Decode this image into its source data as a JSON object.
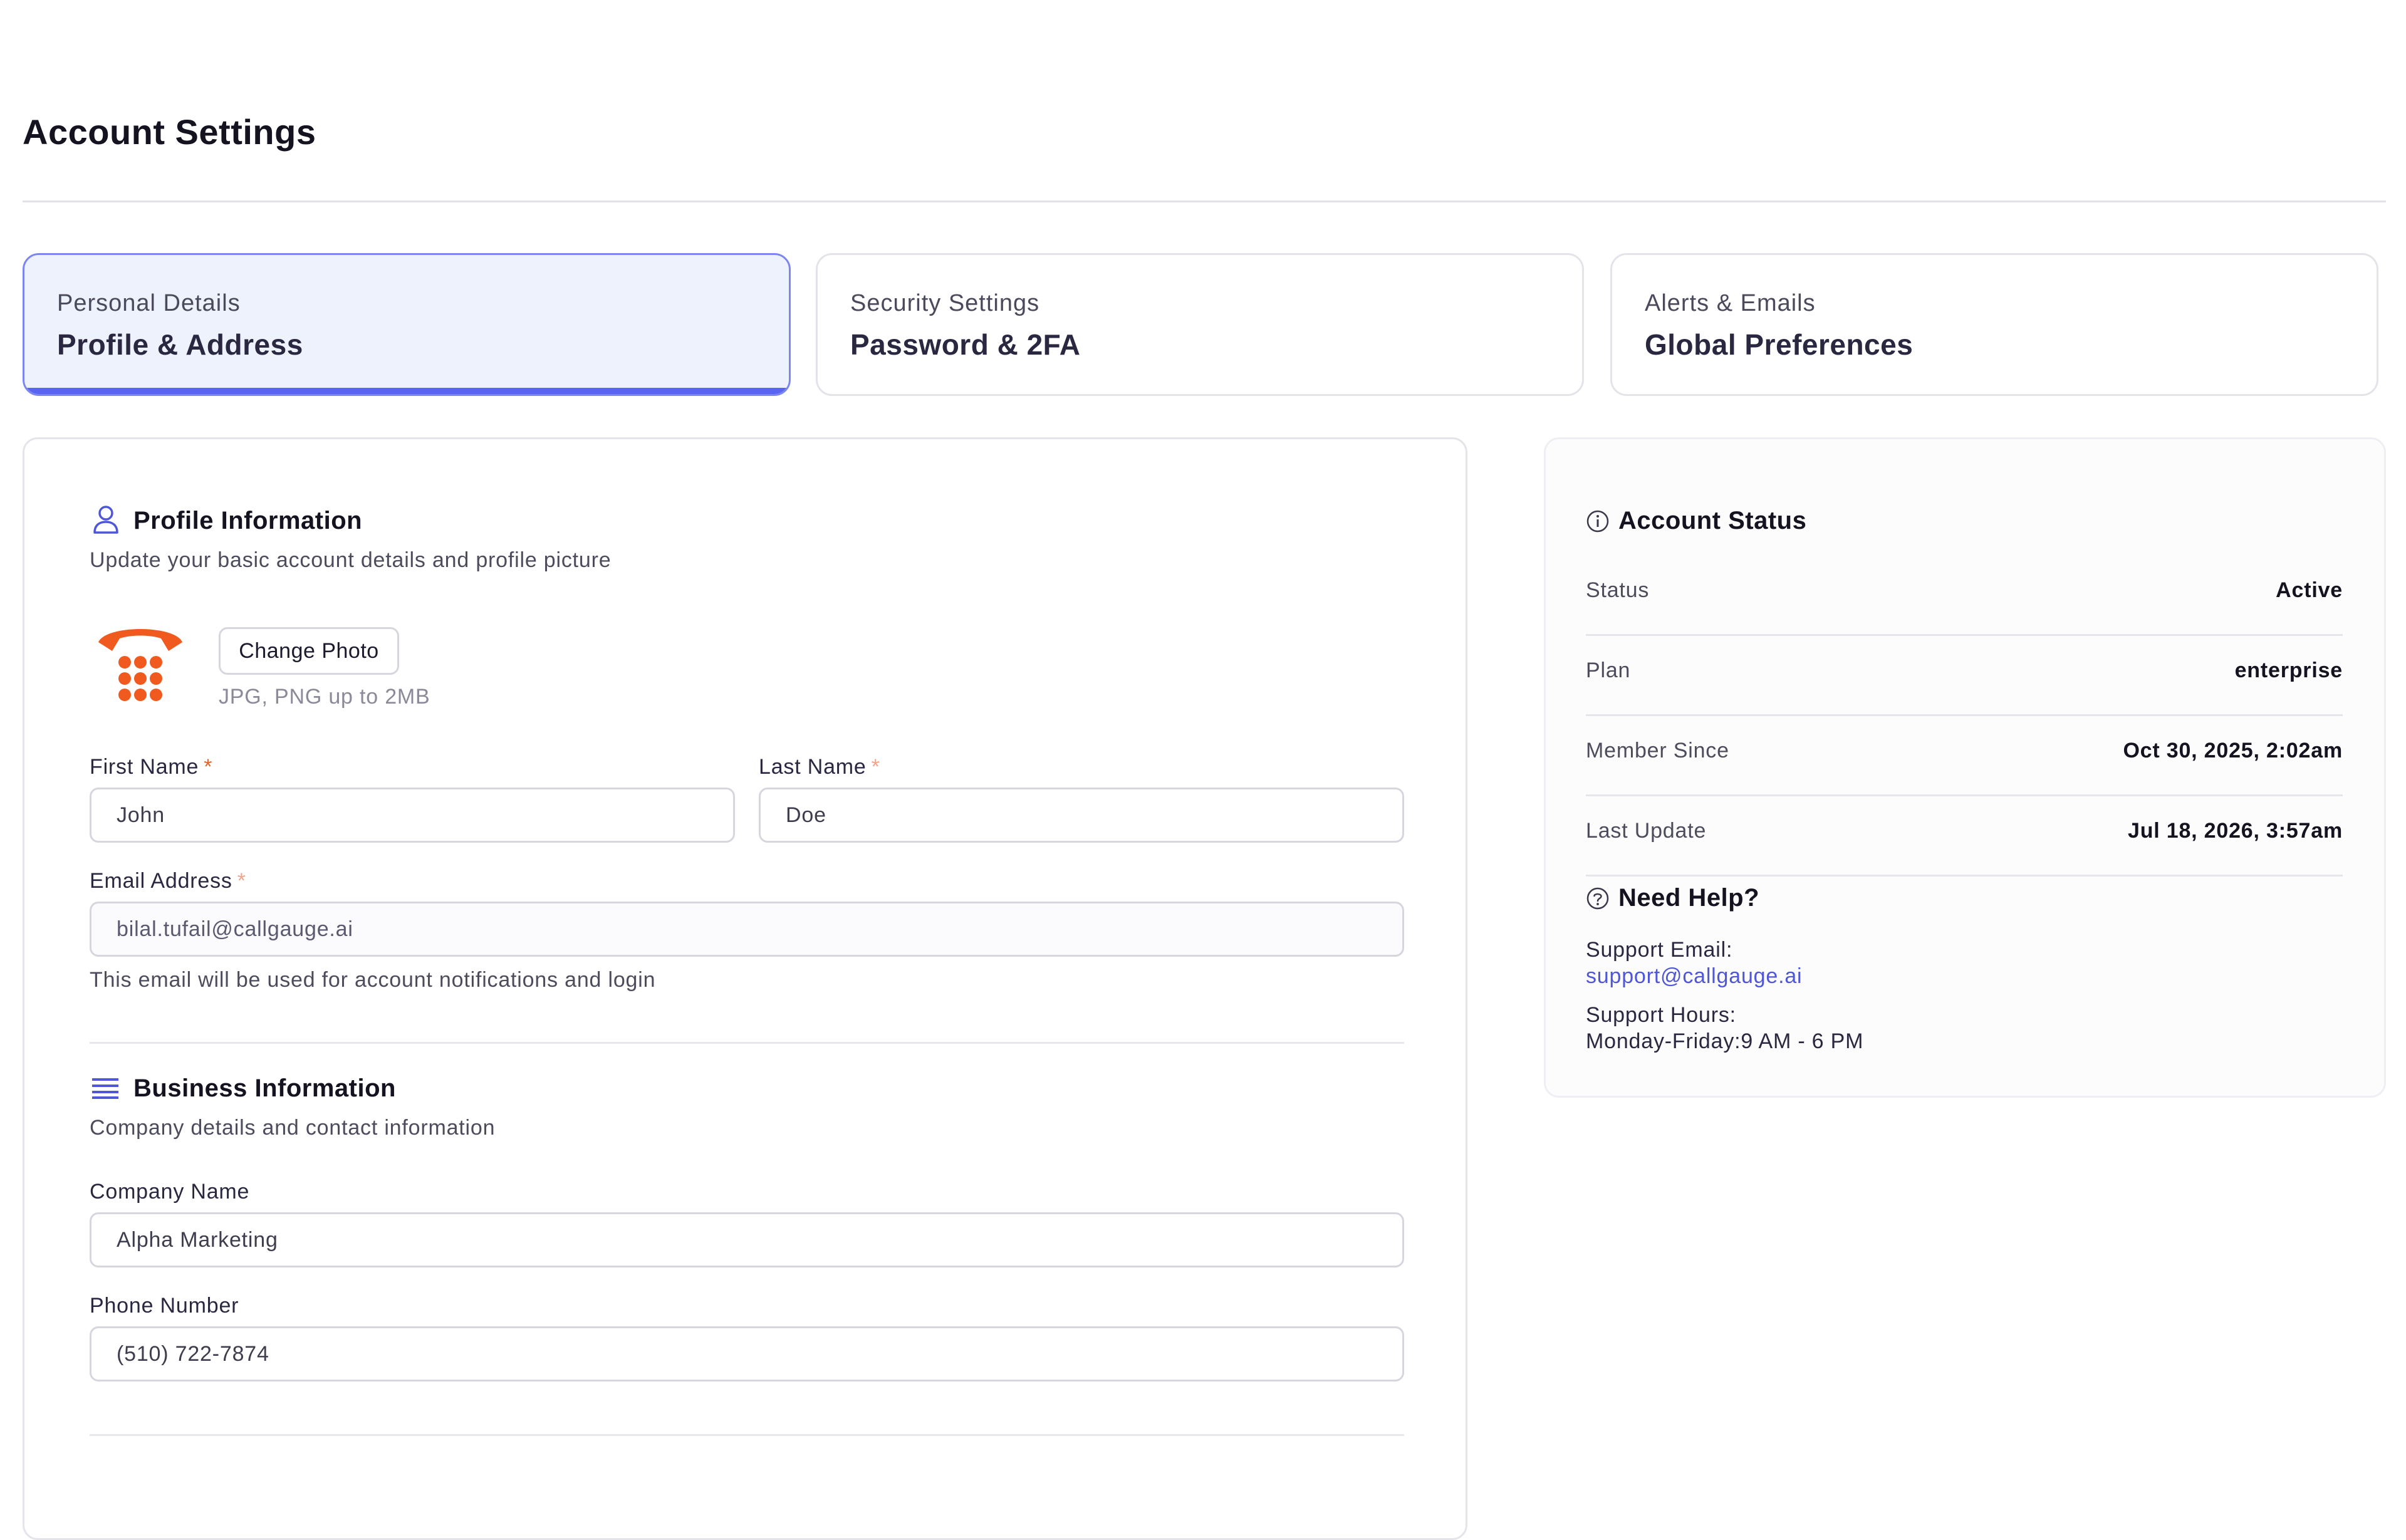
{
  "header": {
    "title": "Account Settings"
  },
  "tabs": [
    {
      "subtitle": "Personal Details",
      "title": "Profile & Address",
      "active": true
    },
    {
      "subtitle": "Security Settings",
      "title": "Password & 2FA",
      "active": false
    },
    {
      "subtitle": "Alerts & Emails",
      "title": "Global Preferences",
      "active": false
    }
  ],
  "profile": {
    "title": "Profile Information",
    "description": "Update your basic account details and profile picture",
    "change_photo_label": "Change Photo",
    "photo_hint": "JPG, PNG up to 2MB",
    "first_name": {
      "label": "First Name",
      "required_mark": "*",
      "value": "John"
    },
    "last_name": {
      "label": "Last Name",
      "required_mark": "*",
      "value": "Doe"
    },
    "email": {
      "label": "Email Address",
      "required_mark": "*",
      "value": "bilal.tufail@callgauge.ai",
      "help": "This email will be used for account notifications and login"
    }
  },
  "business": {
    "title": "Business Information",
    "description": "Company details and contact information",
    "company": {
      "label": "Company Name",
      "value": "Alpha Marketing"
    },
    "phone": {
      "label": "Phone Number",
      "value": "(510) 722-7874"
    }
  },
  "account_status": {
    "title": "Account Status",
    "rows": [
      {
        "key": "Status",
        "value": "Active"
      },
      {
        "key": "Plan",
        "value": "enterprise"
      },
      {
        "key": "Member Since",
        "value": "Oct 30, 2025, 2:02am"
      },
      {
        "key": "Last Update",
        "value": "Jul 18, 2026, 3:57am"
      }
    ]
  },
  "help": {
    "title": "Need Help?",
    "email_label": "Support Email:",
    "email": "support@callgauge.ai",
    "hours_label": "Support Hours:",
    "hours": "Monday-Friday:9 AM - 6 PM"
  },
  "colors": {
    "accent": "#5964f2",
    "active_tab_bg": "#eef2fd",
    "avatar": "#f05a1e",
    "link": "#4f57d8"
  },
  "icons": [
    "user-icon",
    "list-icon",
    "info-icon",
    "help-circle-icon",
    "phone-avatar-icon"
  ]
}
